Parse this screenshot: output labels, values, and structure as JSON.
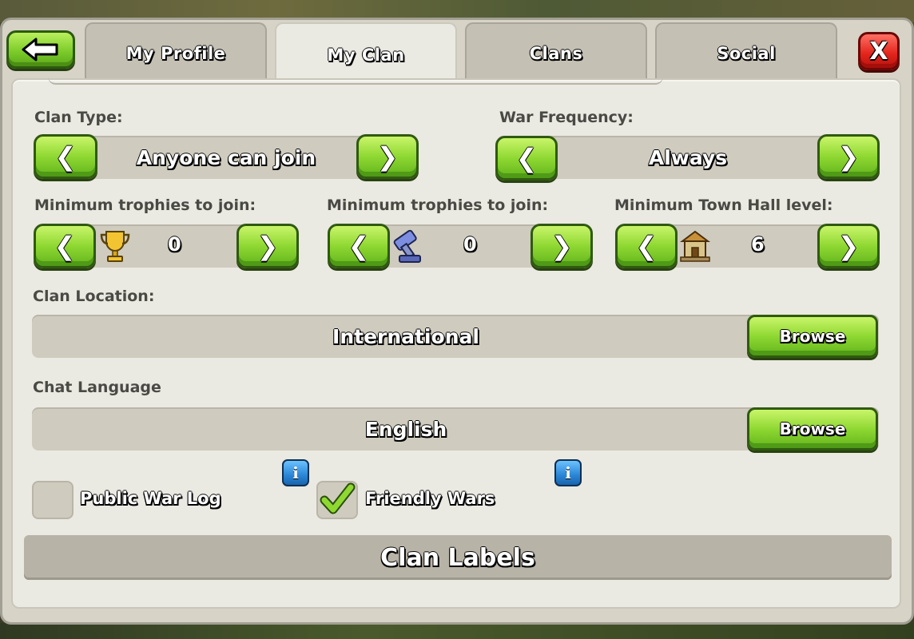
{
  "tabs": [
    {
      "label": "My Profile",
      "active": false
    },
    {
      "label": "My Clan",
      "active": true
    },
    {
      "label": "Clans",
      "active": false
    },
    {
      "label": "Social",
      "active": false
    }
  ],
  "close_label": "X",
  "clan_type": {
    "label": "Clan Type:",
    "value": "Anyone can join"
  },
  "war_frequency": {
    "label": "War Frequency:",
    "value": "Always"
  },
  "min_trophies": {
    "label": "Minimum trophies to join:",
    "value": "0",
    "icon": "trophy-icon"
  },
  "min_war_trophies": {
    "label": "Minimum trophies to join:",
    "value": "0",
    "icon": "war-hammer-icon"
  },
  "min_town_hall": {
    "label": "Minimum Town Hall level:",
    "value": "6",
    "icon": "town-hall-icon"
  },
  "clan_location": {
    "label": "Clan Location:",
    "value": "International",
    "browse_label": "Browse"
  },
  "chat_language": {
    "label": "Chat Language",
    "value": "English",
    "browse_label": "Browse"
  },
  "public_war_log": {
    "label": "Public War Log",
    "checked": false
  },
  "friendly_wars": {
    "label": "Friendly Wars",
    "checked": true
  },
  "info_label": "i",
  "clan_labels": "Clan Labels",
  "colors": {
    "button_green": "#8fd832",
    "close_red": "#e2231a",
    "info_blue": "#2a86d6",
    "panel": "#eae9e2"
  }
}
